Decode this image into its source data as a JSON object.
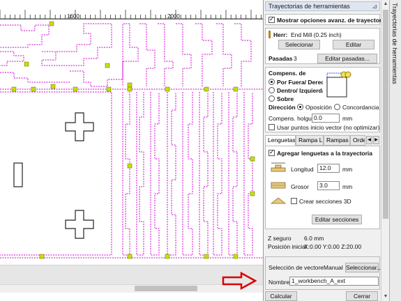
{
  "ruler": {
    "marks": [
      "1600",
      "2000"
    ]
  },
  "panel": {
    "title": "Trayectorias de herramientas",
    "side_tab": "Trayectorias de herramientas",
    "show_advanced_label": "Mostrar opciones avanz. de trayectoria",
    "tool": {
      "label": "Herr:",
      "value": "End Mill (0.25 inch)",
      "select_btn": "Selecionar",
      "edit_btn": "Editar"
    },
    "passes": {
      "label": "Pasadas",
      "value": "3",
      "edit_btn": "Editar pasadas..."
    },
    "offset": {
      "heading": "Compens. de",
      "options": [
        "Por Fuera/ Derecha",
        "Dentro/ Izquierda",
        "Sobre"
      ],
      "direction_label": "Dirección",
      "direction_options": [
        "Oposición",
        "Concordancia"
      ],
      "allowance_label": "Compens. holgura",
      "allowance_value": "0.0",
      "allowance_unit": "mm",
      "start_point_label": "Usar puntos inicio vector (no optimizar)"
    },
    "tabs": [
      "Lenguetas",
      "Rampa L.",
      "Rampas",
      "Orde"
    ],
    "tabs_section": {
      "add_tabs_label": "Agregar lenguetas a la trayectoria",
      "length_label": "Longitud",
      "length_value": "12.0",
      "length_unit": "mm",
      "thickness_label": "Grosor",
      "thickness_value": "3.0",
      "thickness_unit": "mm",
      "sections3d_label": "Crear secciones 3D",
      "edit_sections_btn": "Editar secciones"
    },
    "info": {
      "safe_z_label": "Z seguro",
      "safe_z_value": "6.0 mm",
      "home_label": "Posición inicial",
      "home_value": "X:0.00 Y:0.00 Z:20.00"
    },
    "vector_selection": {
      "label": "Selección de vectoreManual",
      "btn": "Seleccionar..."
    },
    "name": {
      "label": "Nombre:",
      "value": "1_workbench_A_ext"
    },
    "calculate_btn": "Calcular",
    "close_btn": "Cerrar"
  },
  "colors": {
    "toolpath": "#d000d0",
    "tab_marker": "#c8e000",
    "arrow": "#e00000"
  }
}
